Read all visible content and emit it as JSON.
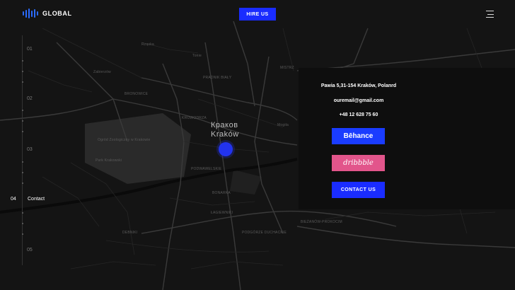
{
  "header": {
    "logo_text": "GLOBAL",
    "hire_label": "HIRE US",
    "menu_icon": "hamburger-menu-icon",
    "logo_icon": "audio-bars-icon"
  },
  "nav": {
    "items": [
      "01",
      "02",
      "03",
      "Contact",
      "05"
    ],
    "active_number": "04"
  },
  "map": {
    "city_cyrillic": "Краков",
    "city_latin": "Kraków",
    "labels": [
      "PRADNIK BIAŁY",
      "BRONOWICE",
      "MISTRZ",
      "Ogród Zoologiczny w Krakowie",
      "Park Krakowski",
      "Mogiła",
      "DEBNIKI",
      "PODGÓRZE DUCHACKIE",
      "BIEŻANÓW-PROKOCIM",
      "PODWAWELSKIE",
      "BONARKA",
      "ŁAGIEWNIKI",
      "KROWODRZA",
      "Tonie",
      "Rząska",
      "Zabierzów"
    ]
  },
  "contact": {
    "address": "Pawia 5,31-154 Kraków, Polanrd",
    "email": "ouremail@gmail.com",
    "phone": "+48 12 628 75 60",
    "behance_label": "Bēhance",
    "dribbble_label": "dribbble",
    "contact_label": "CONTACT US"
  },
  "colors": {
    "accent": "#1a2cff",
    "dribbble": "#e2558b",
    "background": "#0d0d0d"
  }
}
